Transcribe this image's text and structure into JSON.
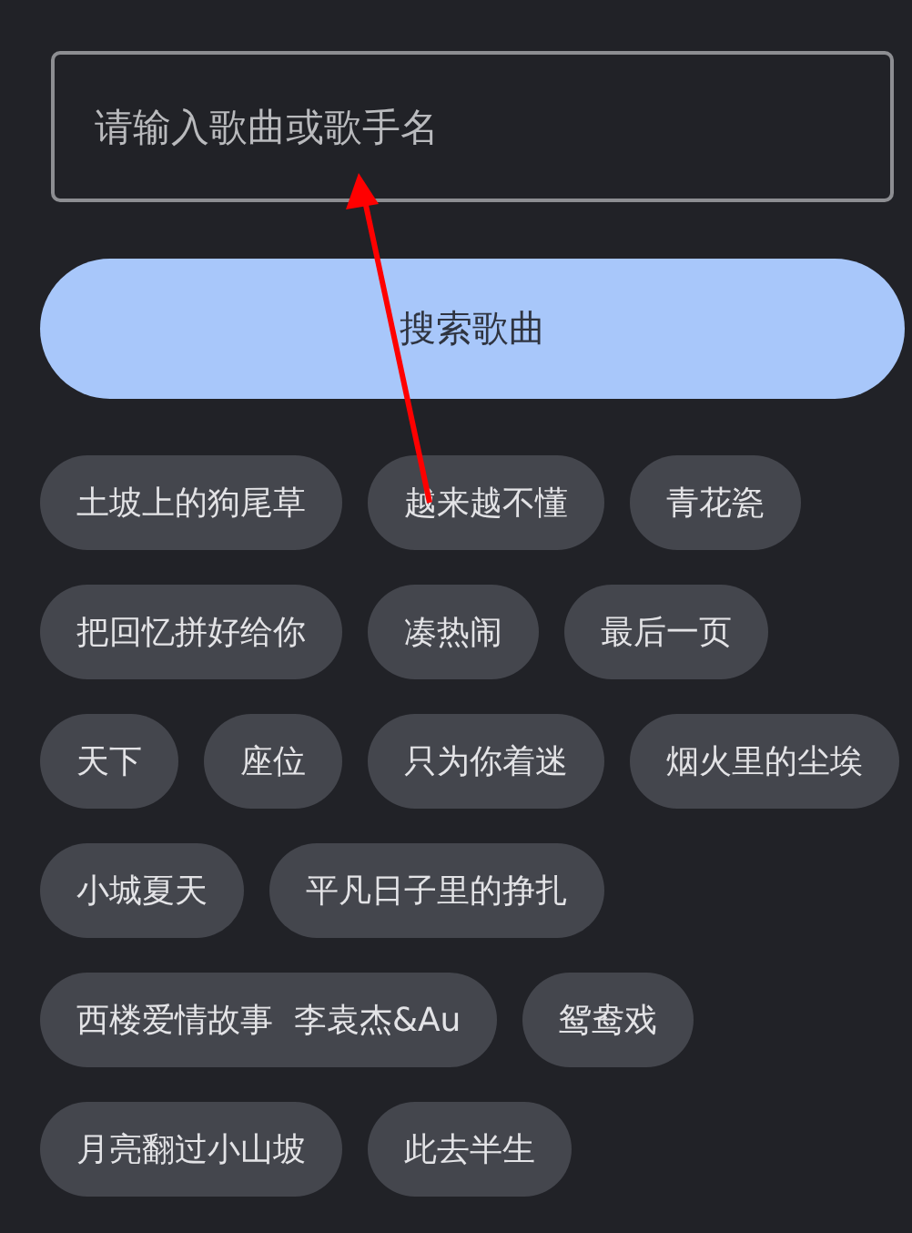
{
  "search": {
    "placeholder": "请输入歌曲或歌手名"
  },
  "search_button": {
    "label": "搜索歌曲"
  },
  "suggestions": [
    {
      "label": "土坡上的狗尾草"
    },
    {
      "label": "越来越不懂"
    },
    {
      "label": "青花瓷"
    },
    {
      "label": "把回忆拼好给你"
    },
    {
      "label": "凑热闹"
    },
    {
      "label": "最后一页"
    },
    {
      "label": "天下"
    },
    {
      "label": "座位"
    },
    {
      "label": "只为你着迷"
    },
    {
      "label": "烟火里的尘埃"
    },
    {
      "label": "小城夏天"
    },
    {
      "label": "平凡日子里的挣扎"
    },
    {
      "label": "西楼爱情故事  李袁杰&Au"
    },
    {
      "label": "鸳鸯戏"
    },
    {
      "label": "月亮翻过小山坡"
    },
    {
      "label": "此去半生"
    }
  ]
}
